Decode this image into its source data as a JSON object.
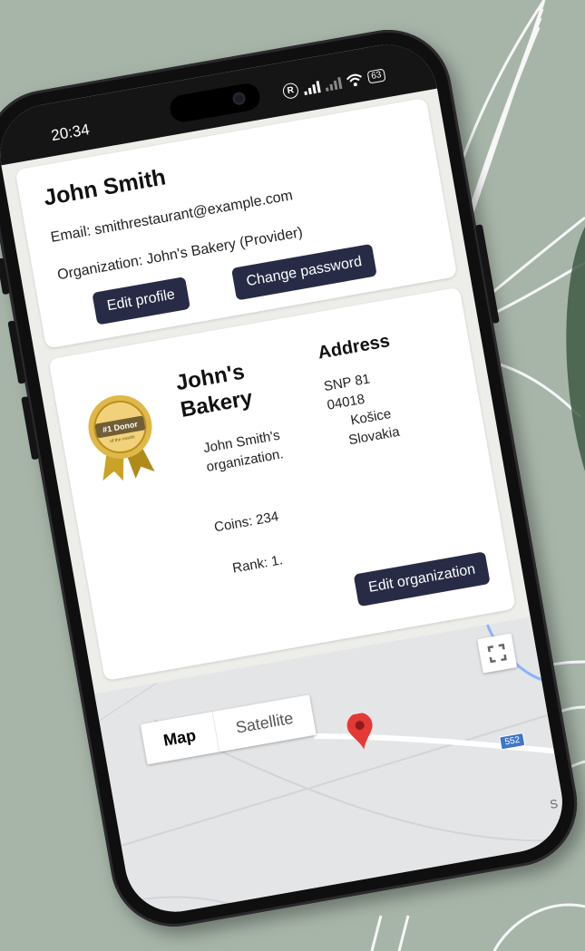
{
  "status_bar": {
    "time": "20:34",
    "battery": "63",
    "indicator_letter": "R"
  },
  "profile": {
    "name": "John Smith",
    "email": "Email: smithrestaurant@example.com",
    "organization": "Organization: John's Bakery (Provider)",
    "edit_profile_label": "Edit profile",
    "change_password_label": "Change password"
  },
  "organization": {
    "name": "John's Bakery",
    "description": "John Smith's organization.",
    "coins": "Coins: 234",
    "rank": "Rank: 1.",
    "badge_text": "#1 Donor",
    "badge_subtext": "of the month",
    "address_title": "Address",
    "address_lines": [
      "SNP 81",
      "04018",
      "Košice",
      "Slovakia"
    ],
    "edit_organization_label": "Edit organization"
  },
  "map": {
    "type_map_label": "Map",
    "type_satellite_label": "Satellite",
    "road_shield": "552",
    "edge_letter": "S"
  },
  "colors": {
    "background": "#a7b5a8",
    "button": "#272b45",
    "pin": "#e53935",
    "water": "#8ab4f8"
  }
}
